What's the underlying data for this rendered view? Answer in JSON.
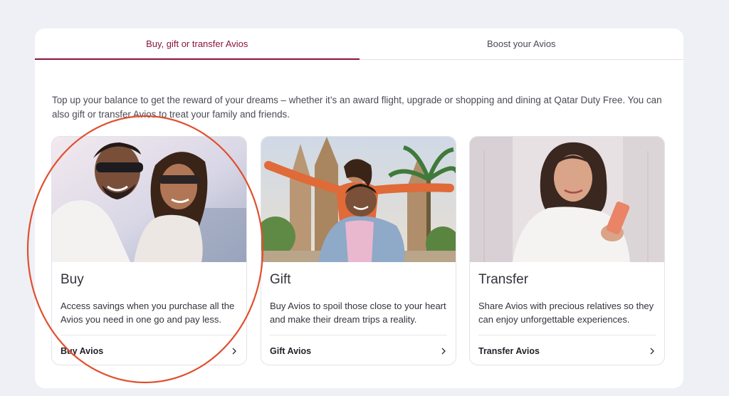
{
  "tabs": [
    {
      "label": "Buy, gift or transfer Avios",
      "active": true
    },
    {
      "label": "Boost your Avios",
      "active": false
    }
  ],
  "intro": "Top up your balance to get the reward of your dreams – whether it’s an award flight, upgrade or shopping and dining at Qatar Duty Free. You can also gift or transfer Avios to treat your family and friends.",
  "cards": [
    {
      "title": "Buy",
      "desc": "Access savings when you purchase all the Avios you need in one go and pay less.",
      "link": "Buy Avios",
      "icon": "chevron-right-icon"
    },
    {
      "title": "Gift",
      "desc": "Buy Avios to spoil those close to your heart and make their dream trips a reality.",
      "link": "Gift Avios",
      "icon": "chevron-right-icon"
    },
    {
      "title": "Transfer",
      "desc": "Share Avios with precious relatives so they can enjoy unforgettable experiences.",
      "link": "Transfer Avios",
      "icon": "chevron-right-icon"
    }
  ],
  "colors": {
    "accent": "#8a1538",
    "annotation": "#e0502e",
    "background": "#eef0f6"
  }
}
